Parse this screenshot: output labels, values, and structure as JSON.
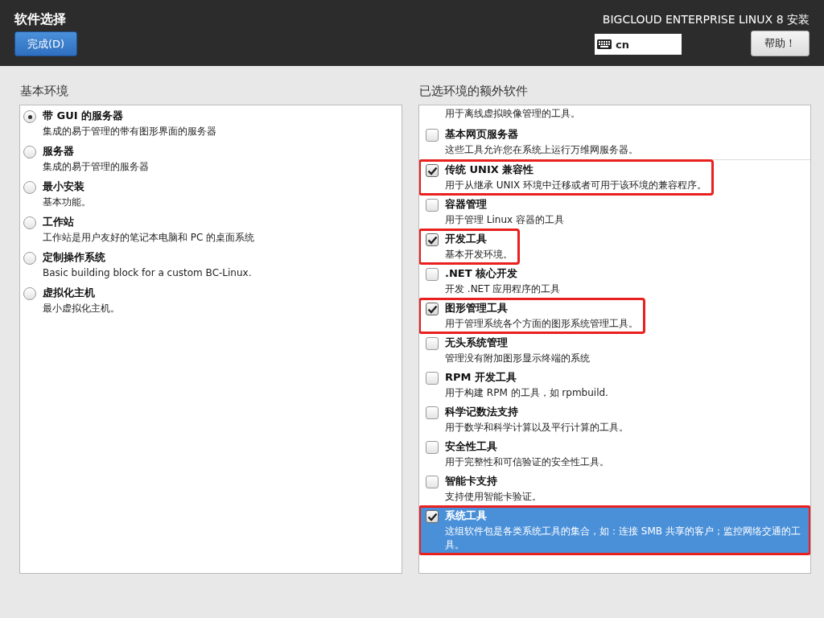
{
  "header": {
    "title": "软件选择",
    "done_button": "完成(D)",
    "product": "BIGCLOUD ENTERPRISE LINUX 8 安装",
    "keyboard": "cn",
    "help_button": "帮助！"
  },
  "base_environment": {
    "heading": "基本环境",
    "items": [
      {
        "name": "带 GUI 的服务器",
        "description": "集成的易于管理的带有图形界面的服务器",
        "selected": true
      },
      {
        "name": "服务器",
        "description": "集成的易于管理的服务器",
        "selected": false
      },
      {
        "name": "最小安装",
        "description": "基本功能。",
        "selected": false
      },
      {
        "name": "工作站",
        "description": "工作站是用户友好的笔记本电脑和 PC 的桌面系统",
        "selected": false
      },
      {
        "name": "定制操作系统",
        "description": "Basic building block for a custom BC-Linux.",
        "selected": false
      },
      {
        "name": "虚拟化主机",
        "description": "最小虚拟化主机。",
        "selected": false
      }
    ]
  },
  "addons": {
    "heading": "已选环境的额外软件",
    "groups": [
      [
        {
          "description": "用于离线虚拟映像管理的工具。",
          "selected": false,
          "annotated": false
        },
        {
          "name": "基本网页服务器",
          "description": "这些工具允许您在系统上运行万维网服务器。",
          "checked": false,
          "selected": false,
          "annotated": false
        }
      ],
      [
        {
          "name": "传统 UNIX 兼容性",
          "description": "用于从继承 UNIX 环境中迁移或者可用于该环境的兼容程序。",
          "checked": true,
          "selected": false,
          "annotated": true
        },
        {
          "name": "容器管理",
          "description": "用于管理 Linux 容器的工具",
          "checked": false,
          "selected": false,
          "annotated": false
        },
        {
          "name": "开发工具",
          "description": "基本开发环境。",
          "checked": true,
          "selected": false,
          "annotated": true
        },
        {
          "name": ".NET 核心开发",
          "description": "开发 .NET 应用程序的工具",
          "checked": false,
          "selected": false,
          "annotated": false
        },
        {
          "name": "图形管理工具",
          "description": "用于管理系统各个方面的图形系统管理工具。",
          "checked": true,
          "selected": false,
          "annotated": true
        },
        {
          "name": "无头系统管理",
          "description": "管理没有附加图形显示终端的系统",
          "checked": false,
          "selected": false,
          "annotated": false
        },
        {
          "name": "RPM 开发工具",
          "description": "用于构建 RPM 的工具，如 rpmbuild.",
          "checked": false,
          "selected": false,
          "annotated": false
        },
        {
          "name": "科学记数法支持",
          "description": "用于数学和科学计算以及平行计算的工具。",
          "checked": false,
          "selected": false,
          "annotated": false
        },
        {
          "name": "安全性工具",
          "description": "用于完整性和可信验证的安全性工具。",
          "checked": false,
          "selected": false,
          "annotated": false
        },
        {
          "name": "智能卡支持",
          "description": "支持使用智能卡验证。",
          "checked": false,
          "selected": false,
          "annotated": false
        },
        {
          "name": "系统工具",
          "description": "这组软件包是各类系统工具的集合，如：连接 SMB 共享的客户；监控网络交通的工具。",
          "checked": true,
          "selected": true,
          "annotated": true
        }
      ]
    ]
  }
}
